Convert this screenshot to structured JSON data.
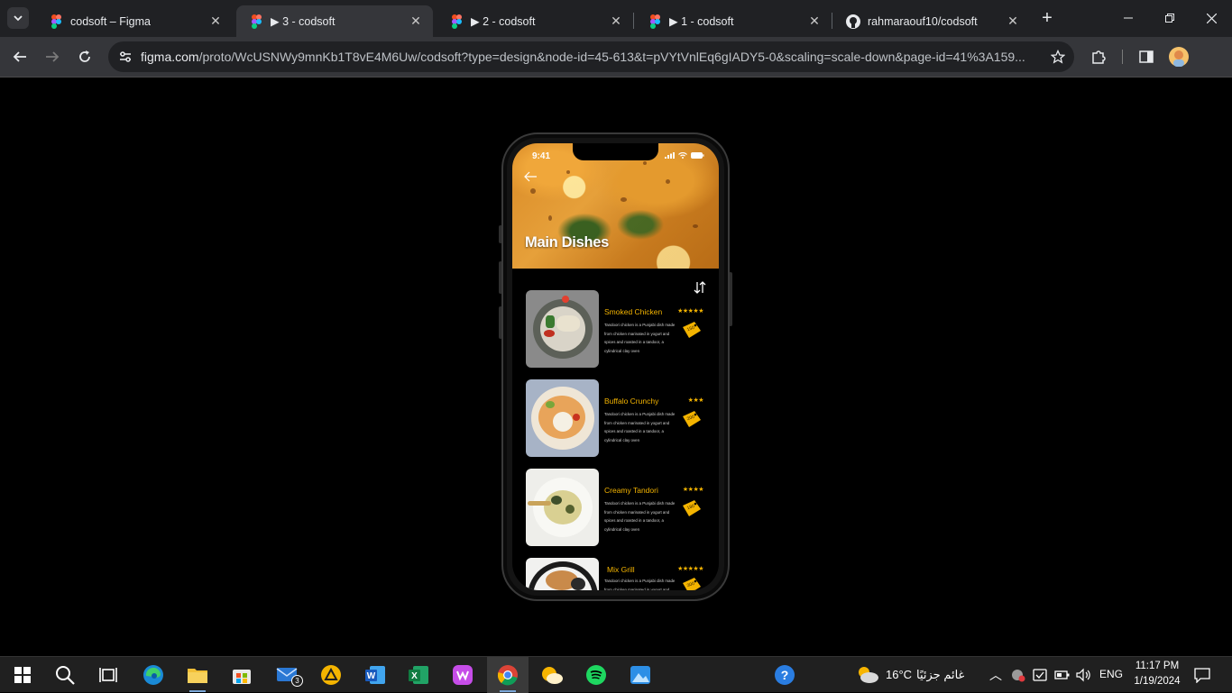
{
  "browser": {
    "tabs": [
      {
        "title": "codsoft – Figma",
        "icon": "figma-icon",
        "active": false
      },
      {
        "title": "▶ 3 - codsoft",
        "icon": "figma-icon",
        "active": true
      },
      {
        "title": "▶ 2 - codsoft",
        "icon": "figma-icon",
        "active": false
      },
      {
        "title": "▶ 1 - codsoft",
        "icon": "figma-icon",
        "active": false
      },
      {
        "title": "rahmaraouf10/codsoft",
        "icon": "github-icon",
        "active": false
      }
    ],
    "url_host": "figma.com",
    "url_path": "/proto/WcUSNWy9mnKb1T8vE4M6Uw/codsoft?type=design&node-id=45-613&t=pVYtVnlEq6gIADY5-0&scaling=scale-down&page-id=41%3A159..."
  },
  "app": {
    "status_time": "9:41",
    "title": "Main Dishes",
    "dishes": [
      {
        "name": "Smoked Chicken",
        "stars": "★★★★★",
        "price": "150",
        "desc": "Tandoori chicken is a Punjabi dish made from chicken marinated in yogurt and spices and roasted in a tandoor, a cylindrical clay oven"
      },
      {
        "name": "Buffalo Crunchy",
        "stars": "★★★",
        "price": "200",
        "desc": "Tandoori chicken is a Punjabi dish made from chicken marinated in yogurt and spices and roasted in a tandoor, a cylindrical clay oven"
      },
      {
        "name": "Creamy Tandori",
        "stars": "★★★★",
        "price": "180",
        "desc": "Tandoori chicken is a Punjabi dish made from chicken marinated in yogurt and spices and roasted in a tandoor, a cylindrical clay oven"
      },
      {
        "name": "Mix Grill",
        "stars": "★★★★★",
        "price": "300",
        "desc": "Tandoori chicken is a Punjabi dish made from chicken marinated in yogurt and spices and"
      }
    ],
    "accent_color": "#f4b400"
  },
  "taskbar": {
    "mail_badge": "3",
    "weather_temp": "16°C",
    "weather_text": "غائم جزئيًا",
    "lang": "ENG",
    "time": "11:17 PM",
    "date": "1/19/2024"
  }
}
